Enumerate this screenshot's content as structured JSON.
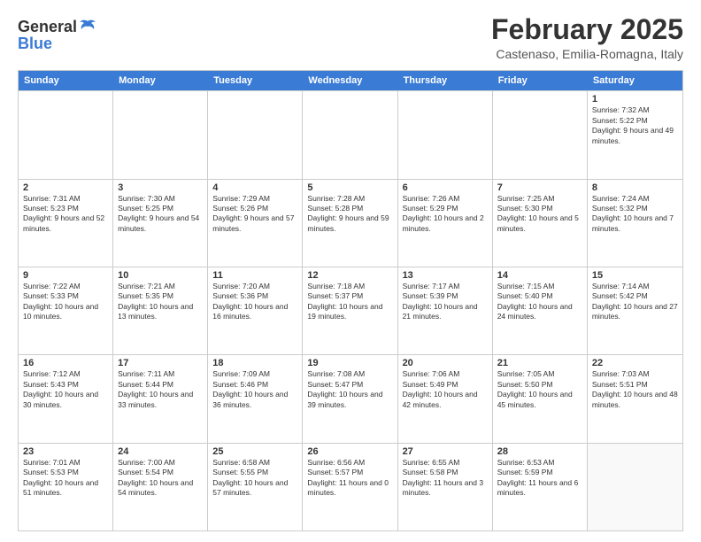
{
  "logo": {
    "general": "General",
    "blue": "Blue"
  },
  "title": "February 2025",
  "subtitle": "Castenaso, Emilia-Romagna, Italy",
  "days_of_week": [
    "Sunday",
    "Monday",
    "Tuesday",
    "Wednesday",
    "Thursday",
    "Friday",
    "Saturday"
  ],
  "weeks": [
    [
      {
        "day": "",
        "info": ""
      },
      {
        "day": "",
        "info": ""
      },
      {
        "day": "",
        "info": ""
      },
      {
        "day": "",
        "info": ""
      },
      {
        "day": "",
        "info": ""
      },
      {
        "day": "",
        "info": ""
      },
      {
        "day": "1",
        "info": "Sunrise: 7:32 AM\nSunset: 5:22 PM\nDaylight: 9 hours and 49 minutes."
      }
    ],
    [
      {
        "day": "2",
        "info": "Sunrise: 7:31 AM\nSunset: 5:23 PM\nDaylight: 9 hours and 52 minutes."
      },
      {
        "day": "3",
        "info": "Sunrise: 7:30 AM\nSunset: 5:25 PM\nDaylight: 9 hours and 54 minutes."
      },
      {
        "day": "4",
        "info": "Sunrise: 7:29 AM\nSunset: 5:26 PM\nDaylight: 9 hours and 57 minutes."
      },
      {
        "day": "5",
        "info": "Sunrise: 7:28 AM\nSunset: 5:28 PM\nDaylight: 9 hours and 59 minutes."
      },
      {
        "day": "6",
        "info": "Sunrise: 7:26 AM\nSunset: 5:29 PM\nDaylight: 10 hours and 2 minutes."
      },
      {
        "day": "7",
        "info": "Sunrise: 7:25 AM\nSunset: 5:30 PM\nDaylight: 10 hours and 5 minutes."
      },
      {
        "day": "8",
        "info": "Sunrise: 7:24 AM\nSunset: 5:32 PM\nDaylight: 10 hours and 7 minutes."
      }
    ],
    [
      {
        "day": "9",
        "info": "Sunrise: 7:22 AM\nSunset: 5:33 PM\nDaylight: 10 hours and 10 minutes."
      },
      {
        "day": "10",
        "info": "Sunrise: 7:21 AM\nSunset: 5:35 PM\nDaylight: 10 hours and 13 minutes."
      },
      {
        "day": "11",
        "info": "Sunrise: 7:20 AM\nSunset: 5:36 PM\nDaylight: 10 hours and 16 minutes."
      },
      {
        "day": "12",
        "info": "Sunrise: 7:18 AM\nSunset: 5:37 PM\nDaylight: 10 hours and 19 minutes."
      },
      {
        "day": "13",
        "info": "Sunrise: 7:17 AM\nSunset: 5:39 PM\nDaylight: 10 hours and 21 minutes."
      },
      {
        "day": "14",
        "info": "Sunrise: 7:15 AM\nSunset: 5:40 PM\nDaylight: 10 hours and 24 minutes."
      },
      {
        "day": "15",
        "info": "Sunrise: 7:14 AM\nSunset: 5:42 PM\nDaylight: 10 hours and 27 minutes."
      }
    ],
    [
      {
        "day": "16",
        "info": "Sunrise: 7:12 AM\nSunset: 5:43 PM\nDaylight: 10 hours and 30 minutes."
      },
      {
        "day": "17",
        "info": "Sunrise: 7:11 AM\nSunset: 5:44 PM\nDaylight: 10 hours and 33 minutes."
      },
      {
        "day": "18",
        "info": "Sunrise: 7:09 AM\nSunset: 5:46 PM\nDaylight: 10 hours and 36 minutes."
      },
      {
        "day": "19",
        "info": "Sunrise: 7:08 AM\nSunset: 5:47 PM\nDaylight: 10 hours and 39 minutes."
      },
      {
        "day": "20",
        "info": "Sunrise: 7:06 AM\nSunset: 5:49 PM\nDaylight: 10 hours and 42 minutes."
      },
      {
        "day": "21",
        "info": "Sunrise: 7:05 AM\nSunset: 5:50 PM\nDaylight: 10 hours and 45 minutes."
      },
      {
        "day": "22",
        "info": "Sunrise: 7:03 AM\nSunset: 5:51 PM\nDaylight: 10 hours and 48 minutes."
      }
    ],
    [
      {
        "day": "23",
        "info": "Sunrise: 7:01 AM\nSunset: 5:53 PM\nDaylight: 10 hours and 51 minutes."
      },
      {
        "day": "24",
        "info": "Sunrise: 7:00 AM\nSunset: 5:54 PM\nDaylight: 10 hours and 54 minutes."
      },
      {
        "day": "25",
        "info": "Sunrise: 6:58 AM\nSunset: 5:55 PM\nDaylight: 10 hours and 57 minutes."
      },
      {
        "day": "26",
        "info": "Sunrise: 6:56 AM\nSunset: 5:57 PM\nDaylight: 11 hours and 0 minutes."
      },
      {
        "day": "27",
        "info": "Sunrise: 6:55 AM\nSunset: 5:58 PM\nDaylight: 11 hours and 3 minutes."
      },
      {
        "day": "28",
        "info": "Sunrise: 6:53 AM\nSunset: 5:59 PM\nDaylight: 11 hours and 6 minutes."
      },
      {
        "day": "",
        "info": ""
      }
    ]
  ]
}
